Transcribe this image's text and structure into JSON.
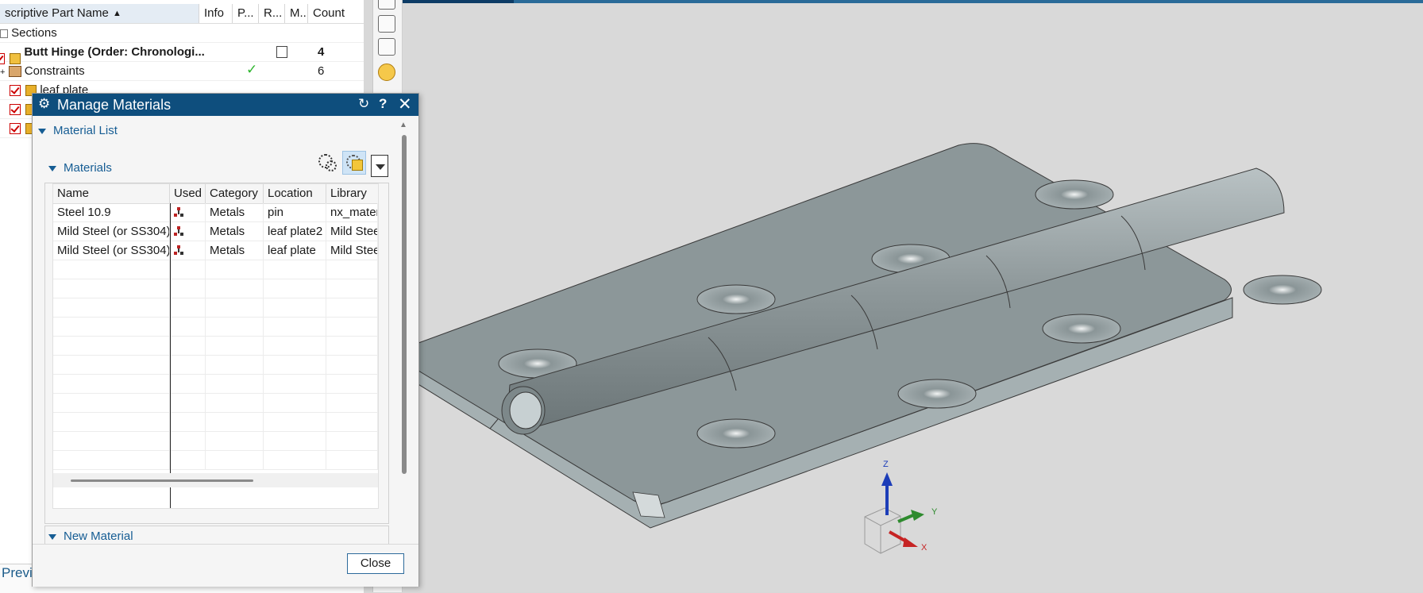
{
  "navigator": {
    "columns": {
      "name": "scriptive Part Name",
      "info": "Info",
      "p": "P...",
      "r": "R...",
      "m": "M...",
      "count": "Count"
    },
    "rows": {
      "sections": "Sections",
      "assembly_name": "Butt Hinge (Order: Chronologi...",
      "assembly_count": "4",
      "constraints": "Constraints",
      "constraints_count": "6",
      "leaf_plate": "leaf plate"
    },
    "bottom_label": "Previ"
  },
  "dialog": {
    "title": "Manage Materials",
    "reset_glyph": "↻",
    "help_glyph": "?",
    "close_glyph": "✕",
    "material_list_label": "Material List",
    "materials_label": "Materials",
    "new_material_label": "New Material",
    "close_button": "Close"
  },
  "materials_table": {
    "headers": [
      "Name",
      "Used",
      "Category",
      "Location",
      "Library"
    ],
    "rows": [
      {
        "name": "Steel 10.9",
        "category": "Metals",
        "location": "pin",
        "library": "nx_mater"
      },
      {
        "name": "Mild Steel (or SS304)",
        "category": "Metals",
        "location": "leaf plate2",
        "library": "Mild Stee"
      },
      {
        "name": "Mild Steel (or SS304)",
        "category": "Metals",
        "location": "leaf plate",
        "library": "Mild Stee"
      }
    ]
  },
  "triad": {
    "z": "Z",
    "y": "Y",
    "x": "X"
  },
  "colors": {
    "dialog_title_bar": "#0e4e7d",
    "section_text": "#165d94",
    "model_surface": "#8c9799",
    "background": "#d9d9d9"
  }
}
